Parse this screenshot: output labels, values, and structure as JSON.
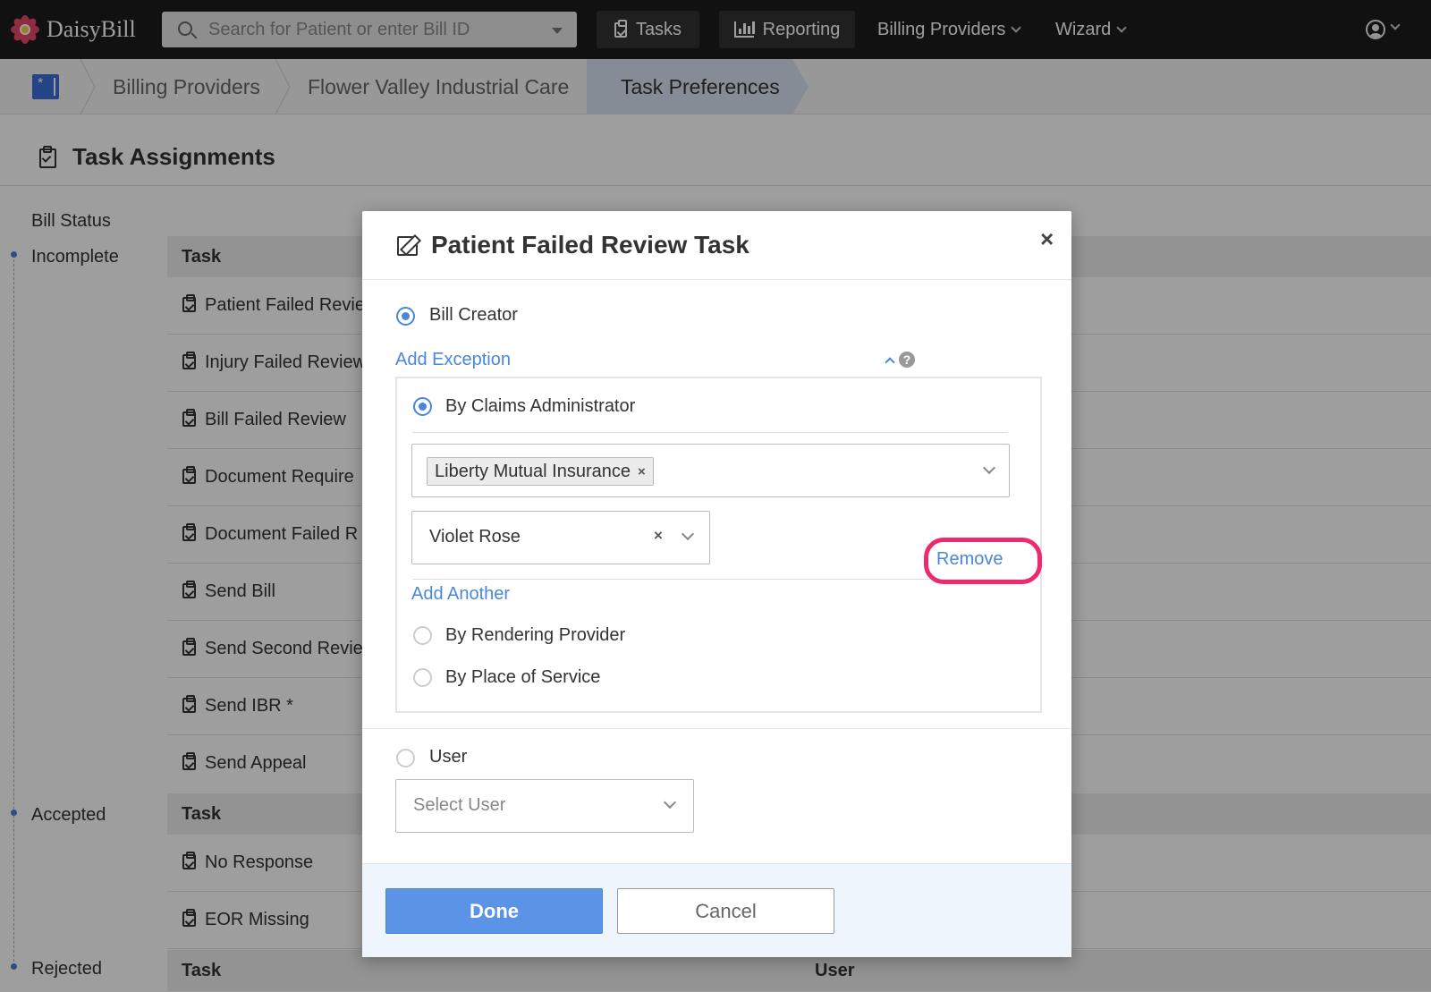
{
  "nav": {
    "brand": "DaisyBill",
    "search_placeholder": "Search for Patient or enter Bill ID",
    "tasks": "Tasks",
    "reporting": "Reporting",
    "billing_providers": "Billing Providers",
    "wizard": "Wizard"
  },
  "breadcrumb": [
    "Billing Providers",
    "Flower Valley Industrial Care",
    "Task Preferences"
  ],
  "page": {
    "title": "Task Assignments",
    "bill_status_label": "Bill Status",
    "statuses": [
      {
        "name": "Incomplete",
        "col_task": "Task",
        "tasks": [
          "Patient Failed Revie",
          "Injury Failed Review",
          "Bill Failed Review",
          "Document Require",
          "Document Failed R",
          "Send Bill",
          "Send Second Revie",
          "Send IBR *",
          "Send Appeal"
        ]
      },
      {
        "name": "Accepted",
        "col_task": "Task",
        "tasks": [
          "No Response",
          "EOR Missing"
        ]
      },
      {
        "name": "Rejected",
        "col_task": "Task",
        "col_user": "User",
        "tasks": []
      }
    ]
  },
  "modal": {
    "title": "Patient Failed Review Task",
    "close": "×",
    "bill_creator": "Bill Creator",
    "add_exception": "Add Exception",
    "help": "?",
    "by_claims_admin": "By Claims Administrator",
    "admin_tag": "Liberty Mutual Insurance",
    "tag_remove": "×",
    "assignee_value": "Violet Rose",
    "clear": "×",
    "remove": "Remove",
    "add_another": "Add Another",
    "by_rendering_provider": "By Rendering Provider",
    "by_place_of_service": "By Place of Service",
    "user": "User",
    "select_user_placeholder": "Select User",
    "done": "Done",
    "cancel": "Cancel"
  },
  "colors": {
    "accent": "#4a87dc",
    "highlight": "#ef2a6c",
    "nav_bg": "#1c1c1c"
  }
}
